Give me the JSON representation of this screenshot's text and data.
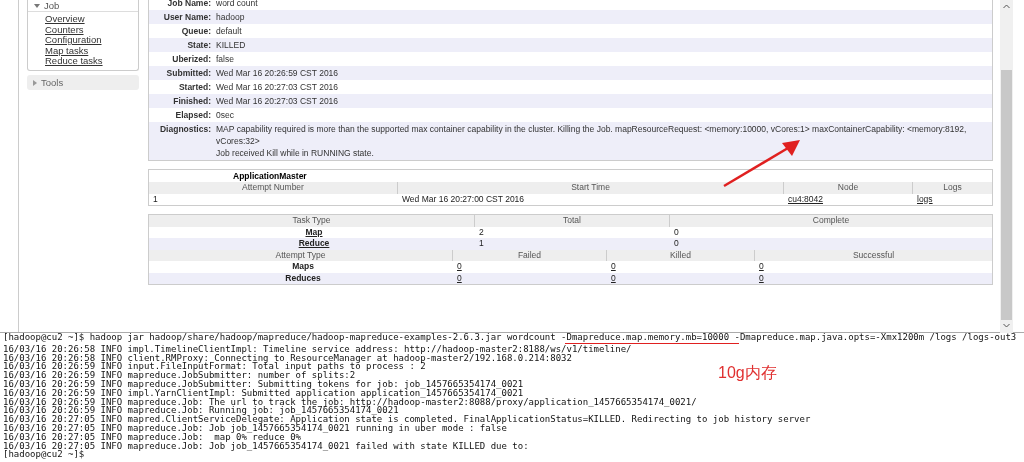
{
  "sidebar": {
    "job_section": {
      "label": "Job",
      "expanded": true,
      "links": [
        "Overview",
        "Counters",
        "Configuration",
        "Map tasks",
        "Reduce tasks"
      ]
    },
    "tools_section": {
      "label": "Tools",
      "expanded": false
    }
  },
  "job_info": [
    {
      "label": "Job Name:",
      "value": [
        "word count"
      ]
    },
    {
      "label": "User Name:",
      "value": [
        "hadoop"
      ]
    },
    {
      "label": "Queue:",
      "value": [
        "default"
      ]
    },
    {
      "label": "State:",
      "value": [
        "KILLED"
      ]
    },
    {
      "label": "Uberized:",
      "value": [
        "false"
      ]
    },
    {
      "label": "Submitted:",
      "value": [
        "Wed Mar 16 20:26:59 CST 2016"
      ]
    },
    {
      "label": "Started:",
      "value": [
        "Wed Mar 16 20:27:03 CST 2016"
      ]
    },
    {
      "label": "Finished:",
      "value": [
        "Wed Mar 16 20:27:03 CST 2016"
      ]
    },
    {
      "label": "Elapsed:",
      "value": [
        "0sec"
      ]
    },
    {
      "label": "Diagnostics:",
      "value": [
        "MAP capability required is more than the supported max container capability in the cluster. Killing the Job. mapResourceRequest: <memory:10000, vCores:1> maxContainerCapability: <memory:8192, vCores:32>",
        "Job received Kill while in RUNNING state."
      ]
    }
  ],
  "application_master": {
    "title": "ApplicationMaster",
    "columns": [
      "Attempt Number",
      "Start Time",
      "Node",
      "Logs"
    ],
    "rows": [
      {
        "attempt": "1",
        "start_time": "Wed Mar 16 20:27:00 CST 2016",
        "node": "cu4:8042",
        "logs": "logs"
      }
    ]
  },
  "tasks": {
    "columns": [
      "Task Type",
      "Total",
      "Complete"
    ],
    "rows": [
      {
        "type": "Map",
        "total": "2",
        "complete": "0"
      },
      {
        "type": "Reduce",
        "total": "1",
        "complete": "0"
      }
    ],
    "attempt_columns": [
      "Attempt Type",
      "Failed",
      "Killed",
      "Successful"
    ],
    "attempt_rows": [
      {
        "type": "Maps",
        "failed": "0",
        "killed": "0",
        "successful": "0"
      },
      {
        "type": "Reduces",
        "failed": "0",
        "killed": "0",
        "successful": "0"
      }
    ]
  },
  "terminal": {
    "lines": [
      "[hadoop@cu2 ~]$ hadoop jar hadoop/share/hadoop/mapreduce/hadoop-mapreduce-examples-2.6.3.jar wordcount -Dmapreduce.map.memory.mb=10000 -Dmapreduce.map.java.opts=-Xmx1200m /logs /logs-out3",
      "16/03/16 20:26:58 INFO impl.TimelineClientImpl: Timeline service address: http://hadoop-master2:8188/ws/v1/timeline/",
      "16/03/16 20:26:58 INFO client.RMProxy: Connecting to ResourceManager at hadoop-master2/192.168.0.214:8032",
      "16/03/16 20:26:59 INFO input.FileInputFormat: Total input paths to process : 2",
      "16/03/16 20:26:59 INFO mapreduce.JobSubmitter: number of splits:2",
      "16/03/16 20:26:59 INFO mapreduce.JobSubmitter: Submitting tokens for job: job_1457665354174_0021",
      "16/03/16 20:26:59 INFO impl.YarnClientImpl: Submitted application application_1457665354174_0021",
      "16/03/16 20:26:59 INFO mapreduce.Job: The url to track the job: http://hadoop-master2:8088/proxy/application_1457665354174_0021/",
      "16/03/16 20:26:59 INFO mapreduce.Job: Running job: job_1457665354174_0021",
      "16/03/16 20:27:05 INFO mapred.ClientServiceDelegate: Application state is completed. FinalApplicationStatus=KILLED. Redirecting to job history server",
      "16/03/16 20:27:05 INFO mapreduce.Job: Job job_1457665354174_0021 running in uber mode : false",
      "16/03/16 20:27:05 INFO mapreduce.Job:  map 0% reduce 0%",
      "16/03/16 20:27:05 INFO mapreduce.Job: Job job_1457665354174_0021 failed with state KILLED due to:",
      "[hadoop@cu2 ~]$"
    ]
  },
  "annotation": {
    "text": "10g内存"
  }
}
